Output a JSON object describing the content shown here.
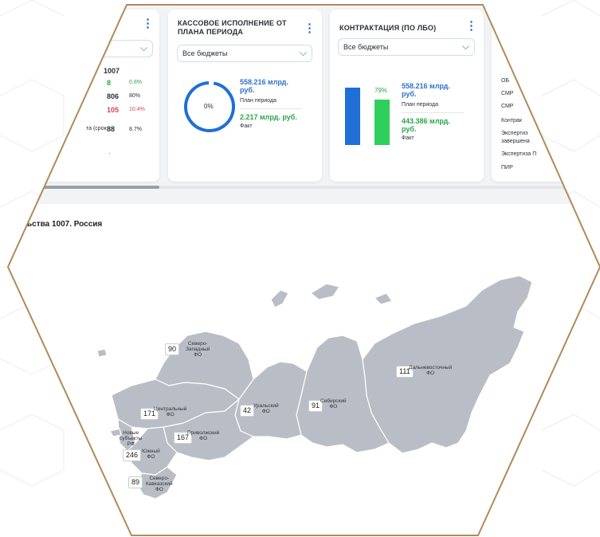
{
  "left_card": {
    "total": "1007",
    "rows": [
      {
        "label": "",
        "count": "8",
        "pct": "0.8%"
      },
      {
        "label": "",
        "count": "806",
        "pct": "80%"
      },
      {
        "label": "",
        "count": "105",
        "pct": "10.4%"
      },
      {
        "label": "та (срок",
        "count": "88",
        "pct": "8.7%"
      }
    ]
  },
  "cash_card": {
    "title_line1": "КАССОВОЕ ИСПОЛНЕНИЕ ОТ",
    "title_line2": "ПЛАНА ПЕРИОДА",
    "budget_select": "Все бюджеты",
    "gauge_percent": "0%",
    "plan_value_line1": "558.216 млрд.",
    "plan_value_line2": "руб.",
    "plan_label": "План периода",
    "fact_value": "2.217 млрд. руб.",
    "fact_label": "Факт"
  },
  "contract_card": {
    "title": "КОНТРАКТАЦИЯ (ПО ЛБО)",
    "budget_select": "Все бюджеты",
    "bar_percent_label": "79%",
    "plan_value_line1": "558.216 млрд.",
    "plan_value_line2": "руб.",
    "plan_label": "План периода",
    "fact_value_line1": "443.386 млрд.",
    "fact_value_line2": "руб.",
    "fact_label": "Факт",
    "colors": {
      "plan": "#1f6fd6",
      "fact": "#2fcf5c"
    },
    "fact_ratio": 0.79
  },
  "right_card": {
    "items": [
      "ОБ",
      "СМР",
      "СМР",
      "Контрак",
      "Экспертиз",
      "завершена",
      "Экспертиза П",
      "ПИР"
    ]
  },
  "map_section": {
    "title": "ьства 1007. Россия",
    "regions": [
      {
        "count": "90",
        "name_lines": [
          "Северо-",
          "Западный",
          "ФО"
        ]
      },
      {
        "count": "111",
        "name_lines": [
          "Дальневосточный",
          "ФО"
        ]
      },
      {
        "count": "91",
        "name_lines": [
          "Сибирский",
          "ФО"
        ]
      },
      {
        "count": "42",
        "name_lines": [
          "Уральский",
          "ФО"
        ]
      },
      {
        "count": "171",
        "name_lines": [
          "Центральный",
          "ФО"
        ]
      },
      {
        "count": "167",
        "name_lines": [
          "Приволжский",
          "ФО"
        ]
      },
      {
        "count": "",
        "name_lines": [
          "Новые",
          "субъекты",
          "РФ"
        ]
      },
      {
        "count": "246",
        "name_lines": [
          "Южный",
          "ФО"
        ]
      },
      {
        "count": "89",
        "name_lines": [
          "Северо-",
          "Кавказский",
          "ФО"
        ]
      }
    ]
  },
  "colors": {
    "accent": "#1f6fd6",
    "map_fill": "#b9bec6",
    "border": "#b08a5a"
  }
}
